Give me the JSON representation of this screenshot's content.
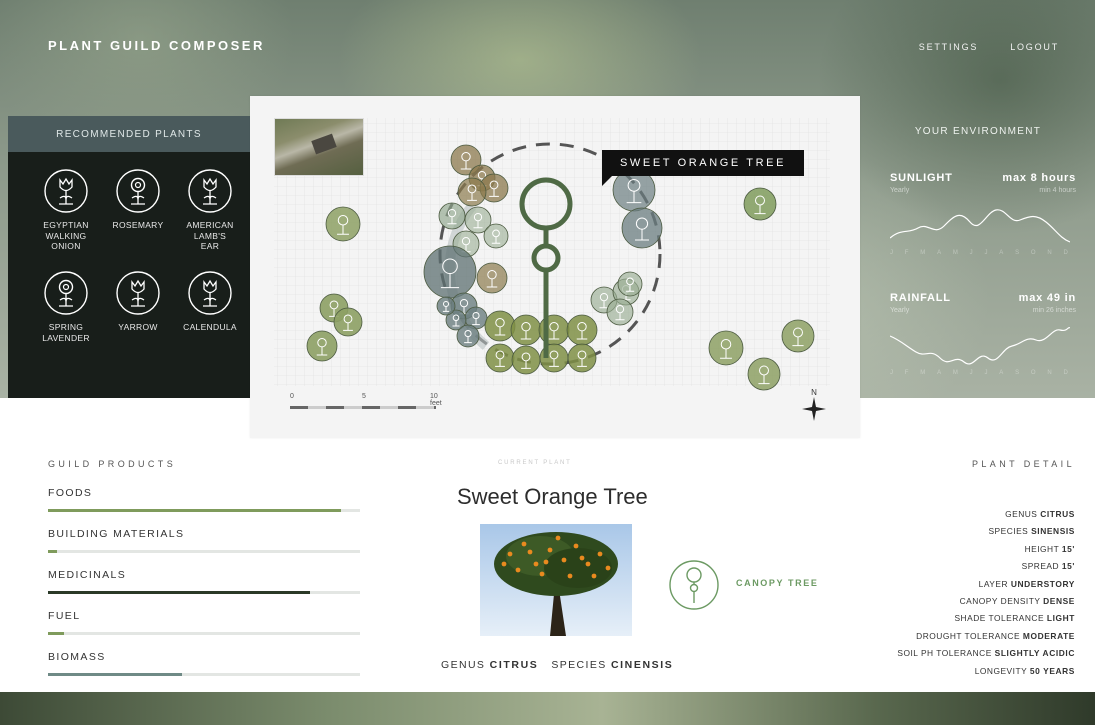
{
  "app": {
    "title": "PLANT GUILD COMPOSER"
  },
  "nav": {
    "settings": "SETTINGS",
    "logout": "LOGOUT"
  },
  "recommended": {
    "title": "RECOMMENDED PLANTS",
    "items": [
      {
        "label": "EGYPTIAN\nWALKING\nONION",
        "icon": "tulip"
      },
      {
        "label": "ROSEMARY",
        "icon": "flower"
      },
      {
        "label": "AMERICAN\nLAMB'S\nEAR",
        "icon": "tulip"
      },
      {
        "label": "SPRING\nLAVENDER",
        "icon": "flower"
      },
      {
        "label": "YARROW",
        "icon": "tulip"
      },
      {
        "label": "CALENDULA",
        "icon": "tulip"
      }
    ]
  },
  "map": {
    "tooltip": "SWEET ORANGE TREE",
    "compass": "N",
    "scale": {
      "labels": [
        "0",
        "5",
        "10 feet"
      ]
    }
  },
  "environment": {
    "title": "YOUR ENVIRONMENT",
    "sunlight": {
      "label": "SUNLIGHT",
      "max": "max 8 hours",
      "period": "Yearly",
      "min": "min 4 hours"
    },
    "rainfall": {
      "label": "RAINFALL",
      "max": "max 49 in",
      "period": "Yearly",
      "min": "min 26 inches"
    },
    "months": [
      "J",
      "F",
      "M",
      "A",
      "M",
      "J",
      "J",
      "A",
      "S",
      "O",
      "N",
      "D"
    ]
  },
  "guild_products": {
    "title": "GUILD PRODUCTS",
    "items": [
      {
        "label": "FOODS",
        "level": 0.94,
        "color": "#7f9b5c"
      },
      {
        "label": "BUILDING MATERIALS",
        "level": 0.03,
        "color": "#7f9b5c"
      },
      {
        "label": "MEDICINALS",
        "level": 0.84,
        "color": "#2b3a28"
      },
      {
        "label": "FUEL",
        "level": 0.05,
        "color": "#7f9b5c"
      },
      {
        "label": "BIOMASS",
        "level": 0.43,
        "color": "#6f8a86"
      }
    ]
  },
  "current_plant": {
    "label": "CURRENT PLANT",
    "name": "Sweet Orange Tree",
    "genus_label": "GENUS",
    "genus": "CITRUS",
    "species_label": "SPECIES",
    "species": "CINENSIS",
    "layer": "CANOPY TREE"
  },
  "plant_detail": {
    "title": "PLANT DETAIL",
    "rows": [
      {
        "k": "GENUS",
        "v": "CITRUS"
      },
      {
        "k": "SPECIES",
        "v": "SINENSIS"
      },
      {
        "k": "HEIGHT",
        "v": "15'"
      },
      {
        "k": "SPREAD",
        "v": "15'"
      },
      {
        "k": "LAYER",
        "v": "UNDERSTORY"
      },
      {
        "k": "CANOPY DENSITY",
        "v": "DENSE"
      },
      {
        "k": "SHADE TOLERANCE",
        "v": "LIGHT"
      },
      {
        "k": "DROUGHT TOLERANCE",
        "v": "MODERATE"
      },
      {
        "k": "SOIL PH TOLERANCE",
        "v": "SLIGHTLY ACIDIC"
      },
      {
        "k": "LONGEVITY",
        "v": "50 YEARS"
      }
    ]
  },
  "colors": {
    "accent": "#6c9a63",
    "panel_dark": "#181e1a",
    "panel_header": "#4a5a5c"
  }
}
